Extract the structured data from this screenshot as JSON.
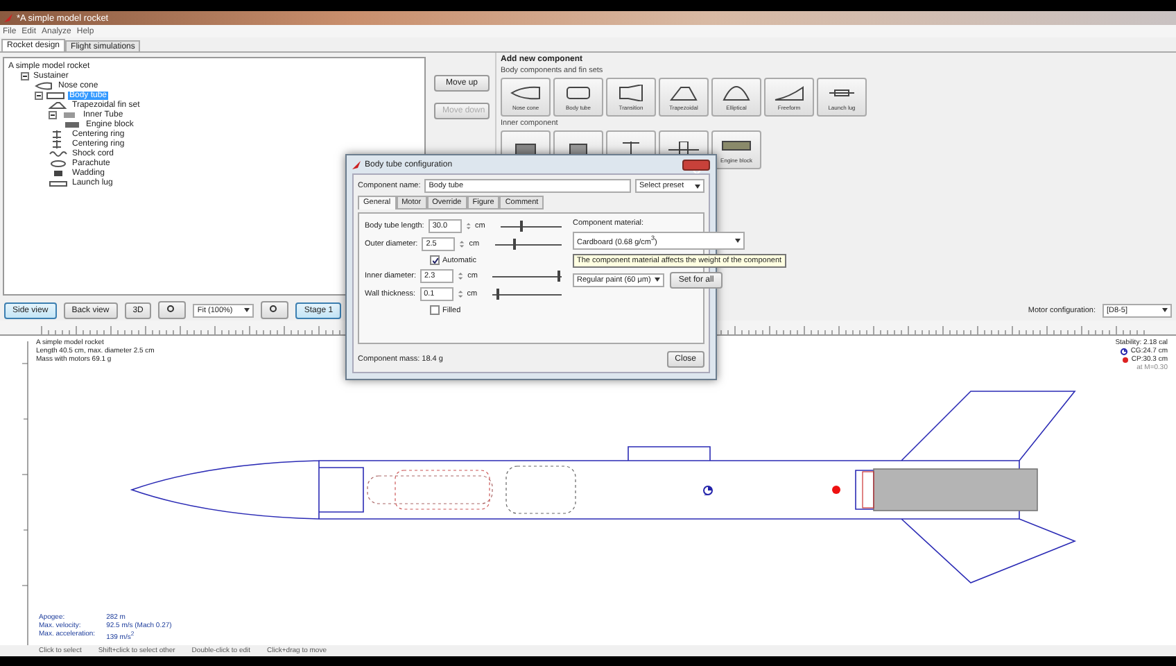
{
  "window": {
    "title": "*A simple model rocket"
  },
  "menu": [
    "File",
    "Edit",
    "Analyze",
    "Help"
  ],
  "tabs": [
    {
      "label": "Rocket design",
      "selected": true
    },
    {
      "label": "Flight simulations",
      "selected": false
    }
  ],
  "tree": [
    {
      "label": "A simple model rocket",
      "selected": false,
      "children": [
        {
          "label": "Sustainer",
          "selected": false,
          "expanded": true,
          "children": [
            {
              "label": "Nose cone",
              "kind": "nose",
              "selected": false
            },
            {
              "label": "Body tube",
              "kind": "tube",
              "selected": true,
              "expanded": true,
              "children": [
                {
                  "label": "Trapezoidal fin set",
                  "kind": "fin",
                  "selected": false
                },
                {
                  "label": "Inner Tube",
                  "kind": "inner",
                  "selected": false,
                  "expanded": true,
                  "children": [
                    {
                      "label": "Engine block",
                      "kind": "block",
                      "selected": false
                    }
                  ]
                },
                {
                  "label": "Centering ring",
                  "kind": "ring",
                  "selected": false
                },
                {
                  "label": "Centering ring",
                  "kind": "ring",
                  "selected": false
                },
                {
                  "label": "Shock cord",
                  "kind": "cord",
                  "selected": false
                },
                {
                  "label": "Parachute",
                  "kind": "chute",
                  "selected": false
                },
                {
                  "label": "Wadding",
                  "kind": "wadding",
                  "selected": false
                },
                {
                  "label": "Launch lug",
                  "kind": "lug",
                  "selected": false
                }
              ]
            }
          ]
        }
      ]
    }
  ],
  "move_buttons": [
    {
      "label": "Move up",
      "disabled": false
    },
    {
      "label": "Move down",
      "disabled": true
    }
  ],
  "add_component": {
    "title": "Add new component",
    "body_heading": "Body components and fin sets",
    "body": [
      {
        "label": "Nose cone",
        "kind": "nose"
      },
      {
        "label": "Body tube",
        "kind": "tube"
      },
      {
        "label": "Transition",
        "kind": "transition"
      },
      {
        "label": "Trapezoidal",
        "kind": "trapezoidal"
      },
      {
        "label": "Elliptical",
        "kind": "elliptical"
      },
      {
        "label": "Freeform",
        "kind": "freeform"
      },
      {
        "label": "Launch lug",
        "kind": "lug"
      }
    ],
    "inner_heading": "Inner component",
    "inner": [
      {
        "kind": "inner"
      },
      {
        "kind": "coupler"
      },
      {
        "kind": "ring"
      },
      {
        "kind": "bulkhead"
      },
      {
        "label": "Engine block",
        "kind": "block"
      }
    ]
  },
  "toolbar": {
    "views": [
      {
        "label": "Side view",
        "selected": true
      },
      {
        "label": "Back view",
        "selected": false
      },
      {
        "label": "3D",
        "selected": false
      }
    ],
    "zoom": "Fit (100%)",
    "stage": {
      "label": "Stage 1",
      "selected": true
    },
    "motor_label": "Motor configuration:",
    "motor": "[D8-5]"
  },
  "canvas": {
    "info": [
      "A simple model rocket",
      "Length 40.5 cm, max. diameter 2.5 cm",
      "Mass with motors 69.1 g"
    ],
    "stability": "Stability:  2.18 cal",
    "cg": "CG:24.7 cm",
    "cp": "CP:30.3 cm",
    "mach": "at M=0.30",
    "flight": [
      {
        "label": "Apogee:",
        "value": "282 m"
      },
      {
        "label": "Max. velocity:",
        "value": "92.5 m/s  (Mach 0.27)"
      },
      {
        "label": "Max. acceleration:",
        "value": "139 m/s$^{2}$"
      }
    ]
  },
  "status_bar": [
    "Click to select",
    "Shift+click to select other",
    "Double-click to edit",
    "Click+drag to move"
  ],
  "dialog": {
    "title": "Body tube configuration",
    "name_label": "Component name:",
    "name": "Body tube",
    "preset": "Select preset",
    "tabs": [
      {
        "label": "General",
        "selected": true
      },
      {
        "label": "Motor",
        "selected": false
      },
      {
        "label": "Override",
        "selected": false
      },
      {
        "label": "Figure",
        "selected": false
      },
      {
        "label": "Comment",
        "selected": false
      }
    ],
    "fields": [
      {
        "label": "Body tube length:",
        "value": "30.0",
        "unit": "cm",
        "level": 0.35
      },
      {
        "label": "Outer diameter:",
        "value": "2.5",
        "unit": "cm",
        "level": 0.3,
        "option": {
          "label": "Automatic",
          "checked": true
        }
      },
      {
        "label": "Inner diameter:",
        "value": "2.3",
        "unit": "cm",
        "level": 0.95
      },
      {
        "label": "Wall thickness:",
        "value": "0.1",
        "unit": "cm",
        "level": 0.08,
        "option": {
          "label": "Filled",
          "checked": false
        }
      }
    ],
    "material_label": "Component material:",
    "material": "Cardboard (0.68 g/cm$^{3}$)",
    "tooltip": "The component material affects the weight of the component",
    "finish": "Regular paint (60 μm)",
    "set_all": "Set for all",
    "mass": "Component mass: 18.4 g",
    "close": "Close"
  }
}
